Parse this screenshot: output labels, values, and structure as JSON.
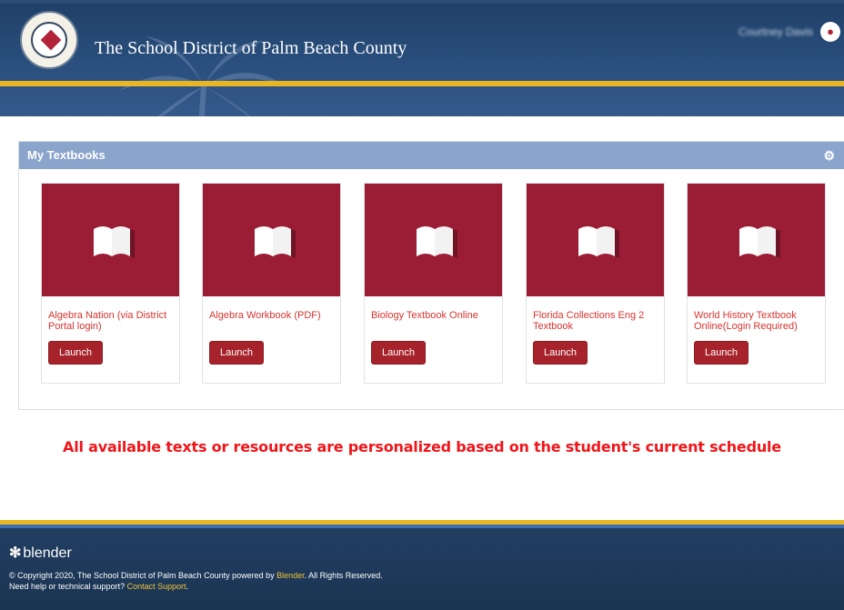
{
  "header": {
    "title": "The School District of Palm Beach County",
    "user_name": "Courtney Davis"
  },
  "panel": {
    "title": "My Textbooks"
  },
  "cards": [
    {
      "title": "Algebra Nation (via District Portal login)",
      "button": "Launch"
    },
    {
      "title": "Algebra Workbook (PDF)",
      "button": "Launch"
    },
    {
      "title": "Biology Textbook Online",
      "button": "Launch"
    },
    {
      "title": "Florida Collections Eng 2 Textbook",
      "button": "Launch"
    },
    {
      "title": "World History Textbook Online(Login Required)",
      "button": "Launch"
    }
  ],
  "notice": "All available texts or resources are personalized based on the student's current schedule",
  "footer": {
    "logo_text": "blender",
    "copyright_prefix": "© Copyright 2020, The School District of Palm Beach County powered by",
    "blender_link": "Blender",
    "copyright_suffix": ". All Rights Reserved.",
    "help_prefix": "Need help or technical support?",
    "contact_link": "Contact Support",
    "help_suffix": "."
  },
  "colors": {
    "header_blue": "#2a4f7e",
    "gold": "#e8b623",
    "card_red": "#9b1d35",
    "launch_red": "#a7232b",
    "title_red": "#d7342f",
    "notice_red": "#f0151a",
    "panel_head": "#8aa4cc"
  },
  "icons": {
    "logo": "school-district-seal",
    "user": "user-icon",
    "settings": "gear-icon",
    "card": "open-book-icon",
    "footer": "blender-logo-icon"
  }
}
